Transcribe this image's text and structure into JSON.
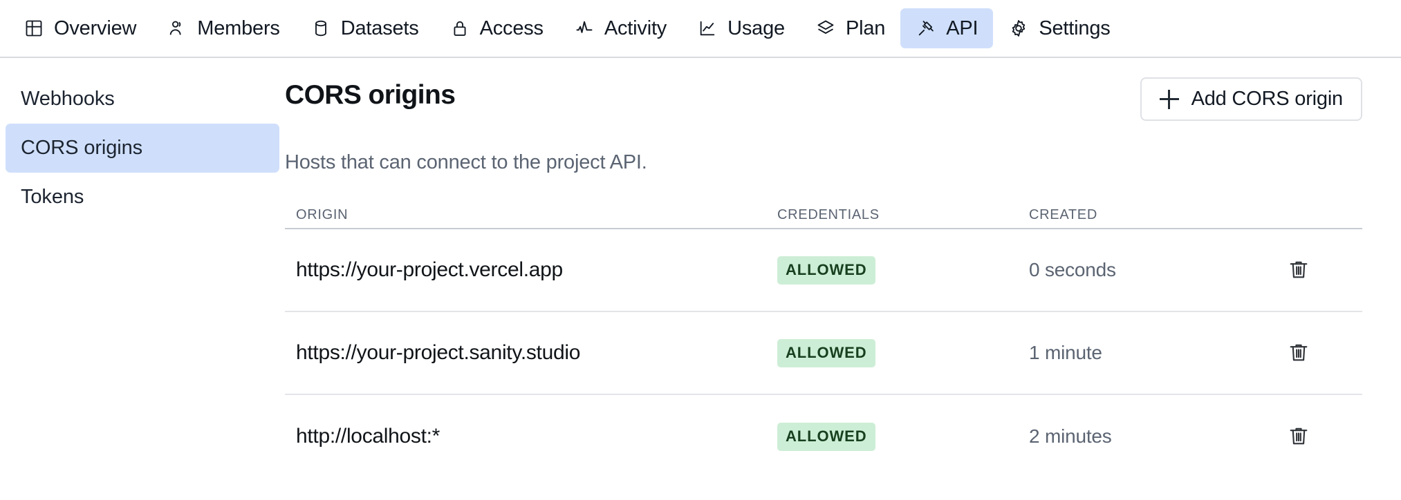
{
  "topnav": {
    "items": [
      {
        "label": "Overview",
        "icon": "layout-grid-icon",
        "active": false
      },
      {
        "label": "Members",
        "icon": "users-icon",
        "active": false
      },
      {
        "label": "Datasets",
        "icon": "database-icon",
        "active": false
      },
      {
        "label": "Access",
        "icon": "lock-icon",
        "active": false
      },
      {
        "label": "Activity",
        "icon": "activity-icon",
        "active": false
      },
      {
        "label": "Usage",
        "icon": "chart-line-icon",
        "active": false
      },
      {
        "label": "Plan",
        "icon": "layers-icon",
        "active": false
      },
      {
        "label": "API",
        "icon": "plug-icon",
        "active": true
      },
      {
        "label": "Settings",
        "icon": "gear-icon",
        "active": false
      }
    ],
    "active_color": "#cfdffb"
  },
  "sidebar": {
    "items": [
      {
        "label": "Webhooks",
        "active": false
      },
      {
        "label": "CORS origins",
        "active": true
      },
      {
        "label": "Tokens",
        "active": false
      }
    ]
  },
  "main": {
    "title": "CORS origins",
    "subtitle": "Hosts that can connect to the project API.",
    "add_button": {
      "label": "Add CORS origin",
      "icon": "plus-icon"
    },
    "table": {
      "columns": [
        "ORIGIN",
        "CREDENTIALS",
        "CREATED"
      ],
      "rows": [
        {
          "origin": "https://your-project.vercel.app",
          "credentials": "ALLOWED",
          "created": "0 seconds",
          "action_icon": "trash-icon"
        },
        {
          "origin": "https://your-project.sanity.studio",
          "credentials": "ALLOWED",
          "created": "1 minute",
          "action_icon": "trash-icon"
        },
        {
          "origin": "http://localhost:*",
          "credentials": "ALLOWED",
          "created": "2 minutes",
          "action_icon": "trash-icon"
        }
      ],
      "badge_colors": {
        "bg": "#cdeed6",
        "text": "#17401f"
      }
    }
  }
}
